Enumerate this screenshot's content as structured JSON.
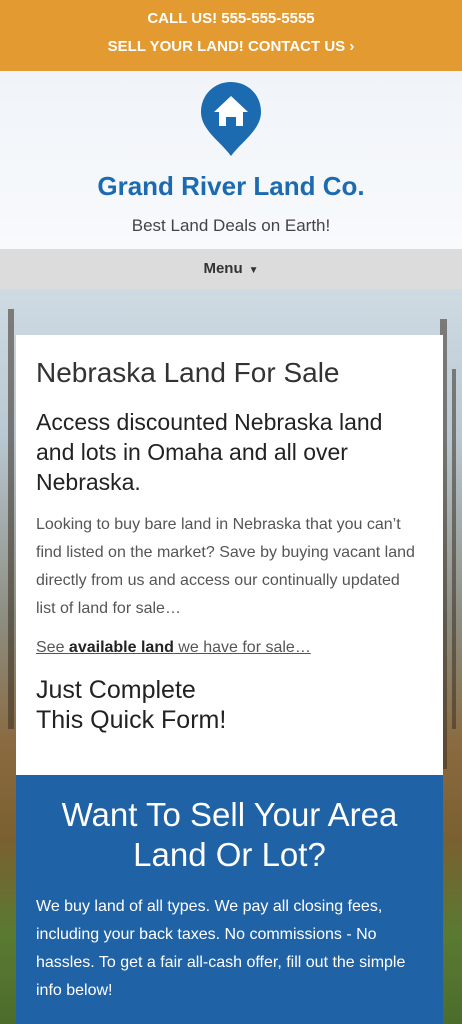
{
  "topbar": {
    "call": "CALL US! 555-555-5555",
    "sell": "SELL YOUR LAND! CONTACT US ›"
  },
  "header": {
    "logo_icon": "house-pin-icon",
    "title": "Grand River Land Co.",
    "tagline": "Best Land Deals on Earth!"
  },
  "menu": {
    "label": "Menu",
    "caret": "▼"
  },
  "content": {
    "heading": "Nebraska Land For Sale",
    "subheading": "Access discounted Nebraska land and lots in Omaha and all over Nebraska.",
    "body": "Looking to buy bare land in Nebraska that you can’t find listed on the market? Save by buying vacant land directly from us and access our continually updated list of land for sale…",
    "see_prefix": "See ",
    "see_link": "available land",
    "see_suffix": " we have for sale…",
    "form_heading_1": "Just Complete",
    "form_heading_2": "This Quick Form!"
  },
  "sell_box": {
    "heading": "Want To Sell Your Area Land Or Lot?",
    "body": "We buy land of all types. We pay all closing fees, including your back taxes. No commissions - No hassles. To get a fair all-cash offer, fill out the simple info below!"
  },
  "colors": {
    "accent": "#e39a30",
    "brand": "#1c6bb0",
    "box": "#1f62a5"
  }
}
